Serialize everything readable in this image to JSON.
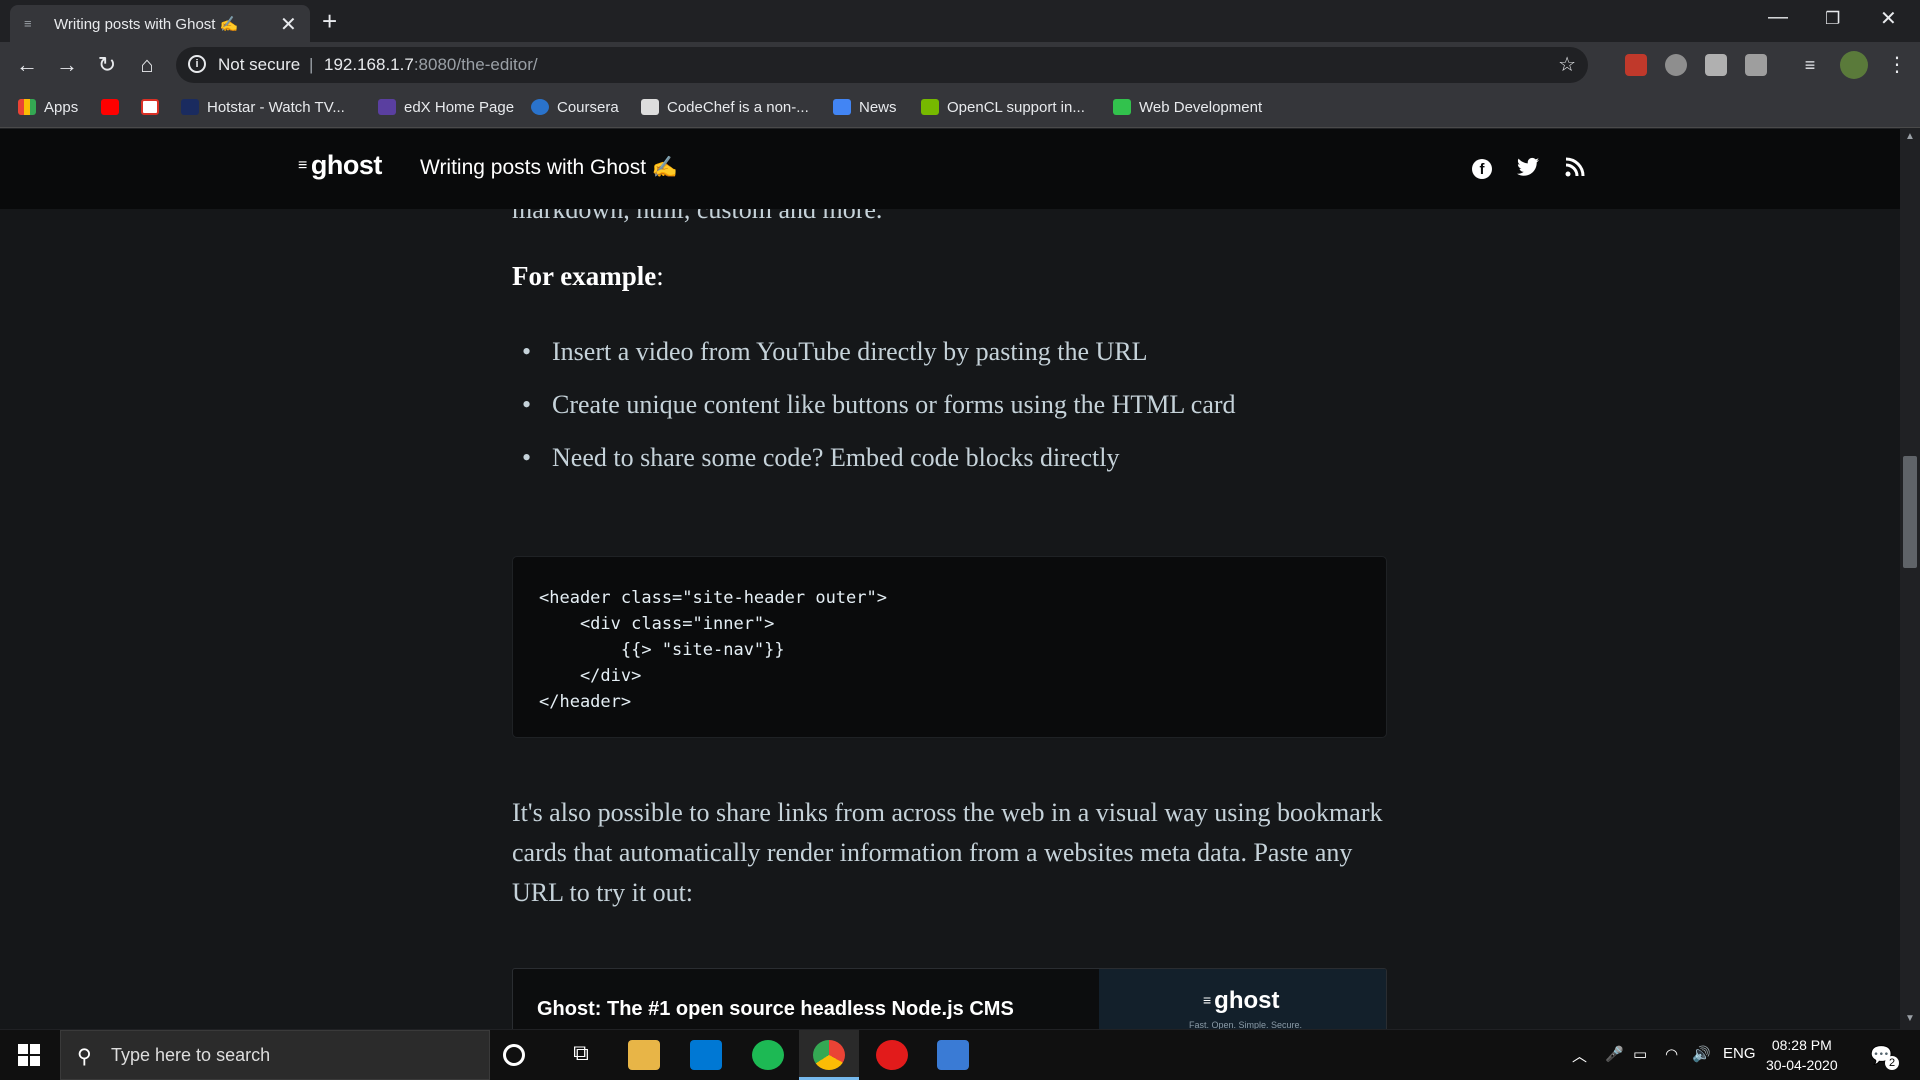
{
  "browser": {
    "tab_title": "Writing posts with Ghost ✍️",
    "tab_favicon": "≡",
    "new_tab_label": "+",
    "address": {
      "security_label": "Not secure",
      "separator": "|",
      "host": "192.168.1.7",
      "path": ":8080/the-editor/"
    },
    "bookmarks": [
      {
        "label": "Apps",
        "icon": "apps-grid-icon",
        "color": "#ea4335"
      },
      {
        "label": "",
        "icon": "youtube-icon",
        "color": "#ff0000"
      },
      {
        "label": "",
        "icon": "gmail-icon",
        "color": "#ffffff"
      },
      {
        "label": "Hotstar - Watch TV...",
        "icon": "hotstar-icon",
        "color": "#1a2b5f"
      },
      {
        "label": "edX Home Page",
        "icon": "edx-icon",
        "color": "#5a3fa0"
      },
      {
        "label": "Coursera",
        "icon": "coursera-icon",
        "color": "#2a73cc"
      },
      {
        "label": "CodeChef is a non-...",
        "icon": "codechef-icon",
        "color": "#dddddd"
      },
      {
        "label": "News",
        "icon": "google-news-icon",
        "color": "#4285f4"
      },
      {
        "label": "OpenCL support in...",
        "icon": "nvidia-icon",
        "color": "#76b900"
      },
      {
        "label": "Web Development",
        "icon": "folder-icon",
        "color": "#32c24d"
      }
    ]
  },
  "site": {
    "logo_mark": "≡",
    "logo": "ghost",
    "nav_title": "Writing posts with Ghost ✍️",
    "social": [
      "f",
      "🐦",
      "〰"
    ]
  },
  "article": {
    "cut_line": "markdown, html, custom and more.",
    "example_heading": "For example",
    "example_colon": ":",
    "bullets": [
      "Insert a video from YouTube directly by pasting the URL",
      "Create unique content like buttons or forms using the HTML card",
      "Need to share some code? Embed code blocks directly"
    ],
    "code": "<header class=\"site-header outer\">\n    <div class=\"inner\">\n        {{> \"site-nav\"}}\n    </div>\n</header>",
    "paragraph": "It's also possible to share links from across the web in a visual way using bookmark cards that automatically render information from a websites meta data. Paste any URL to try it out:",
    "bookmark_card": {
      "title": "Ghost: The #1 open source headless Node.js CMS",
      "thumb_logo": "ghost",
      "thumb_tagline": "Fast. Open. Simple. Secure."
    }
  },
  "taskbar": {
    "search_placeholder": "Type here to search",
    "lang": "ENG",
    "time": "08:28 PM",
    "date": "30-04-2020",
    "notifications": "2"
  }
}
